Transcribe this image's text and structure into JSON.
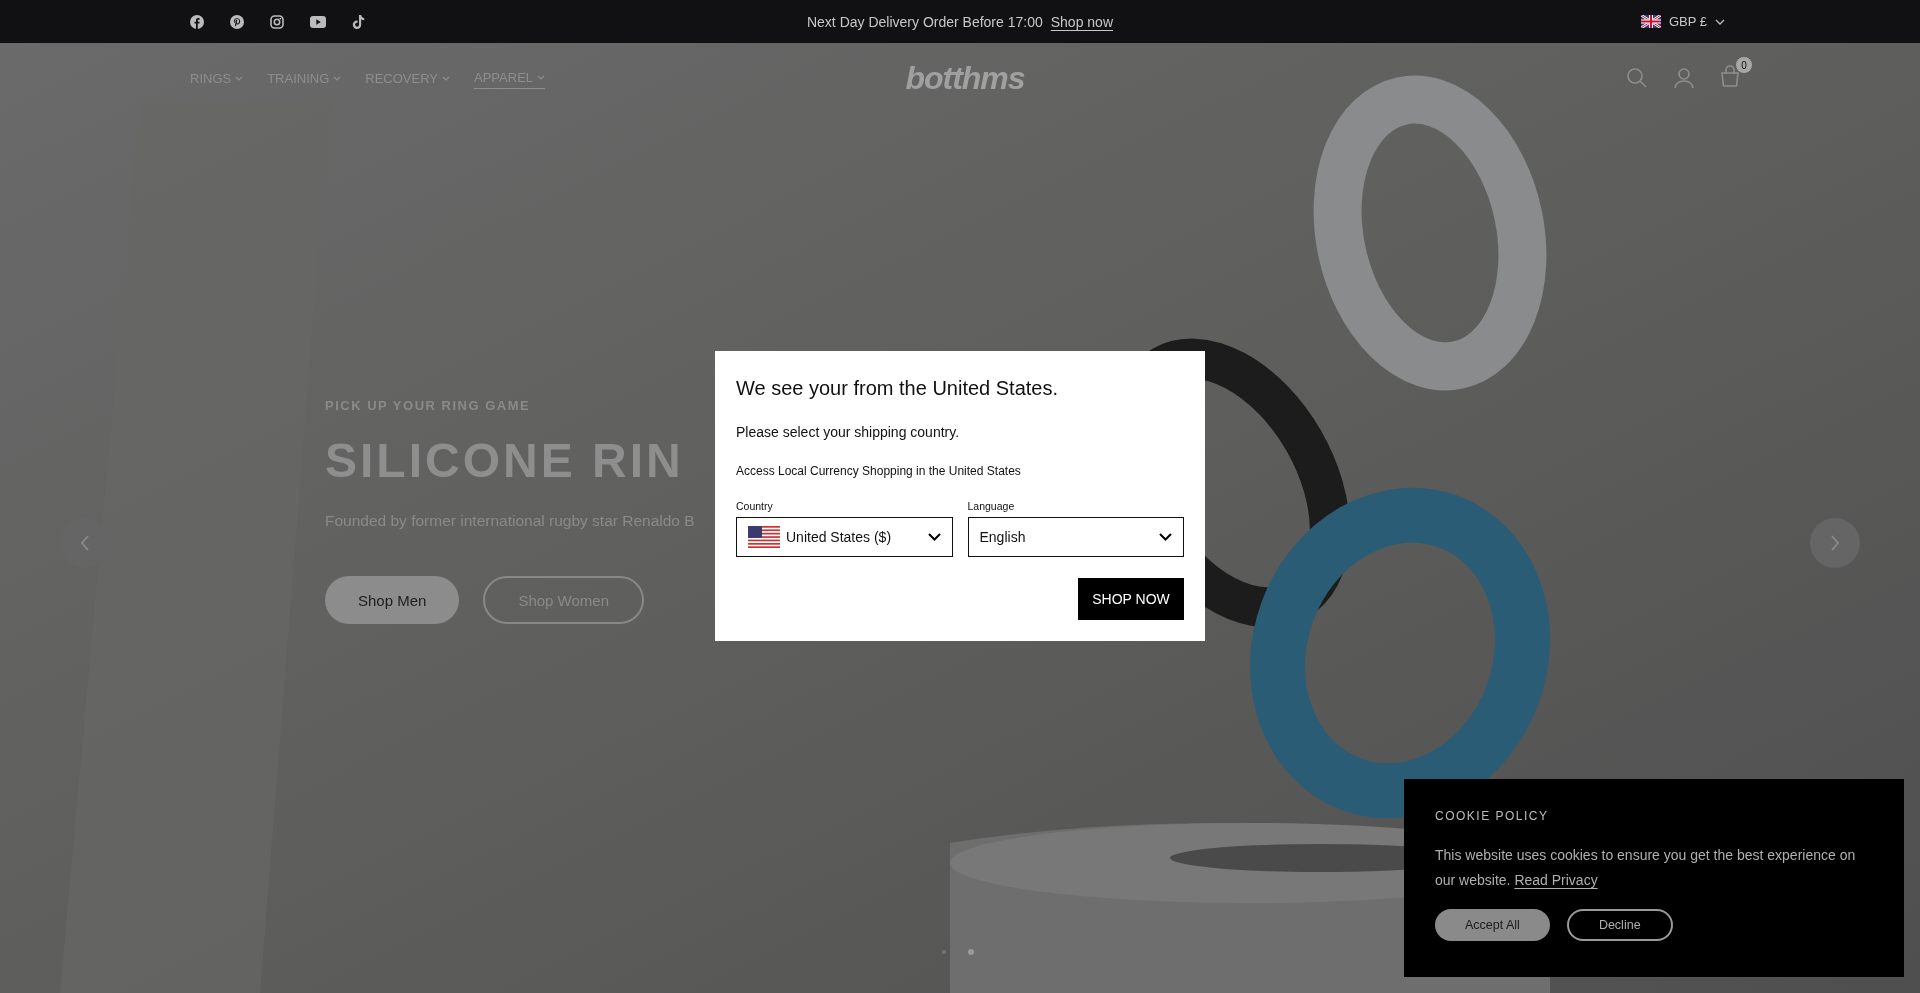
{
  "top_bar": {
    "announcement": "Next Day Delivery Order Before 17:00",
    "link": "Shop now",
    "currency": "GBP £"
  },
  "header": {
    "nav": [
      {
        "label": "RINGS",
        "selected": false
      },
      {
        "label": "TRAINING",
        "selected": false
      },
      {
        "label": "RECOVERY",
        "selected": false
      },
      {
        "label": "APPAREL",
        "selected": true
      }
    ],
    "logo": "botthms",
    "cart_count": "0"
  },
  "hero": {
    "eyebrow": "PICK UP YOUR RING GAME",
    "title": "SILICONE RIN",
    "subtitle": "Founded by former international rugby star Renaldo B",
    "buttons": [
      {
        "label": "Shop Men",
        "kind": "filled"
      },
      {
        "label": "Shop Women",
        "kind": "outline"
      }
    ],
    "dots": [
      {
        "selected": false
      },
      {
        "selected": true
      }
    ]
  },
  "modal": {
    "title": "We see your from the United States.",
    "subtitle": "Please select your shipping country.",
    "note": "Access Local Currency Shopping in the United States",
    "country_label": "Country",
    "country_value": "United States ($)",
    "language_label": "Language",
    "language_value": "English",
    "button": "SHOP NOW"
  },
  "cookie": {
    "title": "COOKIE POLICY",
    "text": "This website uses cookies to ensure you get the best experience on our website.",
    "link": "Read Privacy",
    "buttons": [
      {
        "label": "Accept All",
        "kind": "filled"
      },
      {
        "label": "Decline",
        "kind": "outline"
      }
    ]
  }
}
